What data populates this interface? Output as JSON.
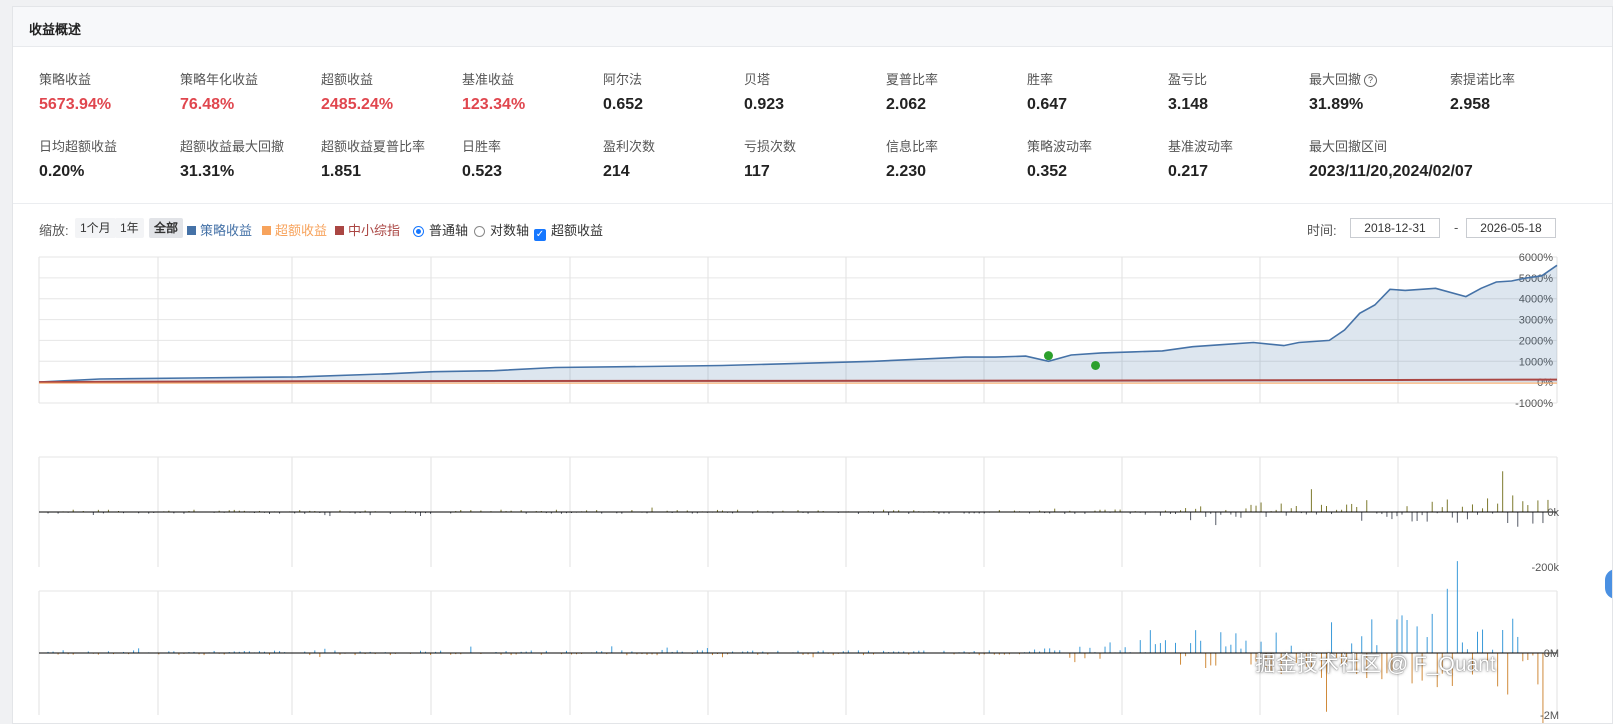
{
  "panel": {
    "title": "收益概述"
  },
  "metrics_row1": [
    {
      "label": "策略收益",
      "value": "5673.94%",
      "red": true
    },
    {
      "label": "策略年化收益",
      "value": "76.48%",
      "red": true
    },
    {
      "label": "超额收益",
      "value": "2485.24%",
      "red": true
    },
    {
      "label": "基准收益",
      "value": "123.34%",
      "red": true
    },
    {
      "label": "阿尔法",
      "value": "0.652",
      "red": false
    },
    {
      "label": "贝塔",
      "value": "0.923",
      "red": false
    },
    {
      "label": "夏普比率",
      "value": "2.062",
      "red": false
    },
    {
      "label": "胜率",
      "value": "0.647",
      "red": false
    },
    {
      "label": "盈亏比",
      "value": "3.148",
      "red": false
    },
    {
      "label": "最大回撤",
      "value": "31.89%",
      "red": false,
      "help": "?"
    },
    {
      "label": "索提诺比率",
      "value": "2.958",
      "red": false
    }
  ],
  "metrics_row2": [
    {
      "label": "日均超额收益",
      "value": "0.20%"
    },
    {
      "label": "超额收益最大回撤",
      "value": "31.31%"
    },
    {
      "label": "超额收益夏普比率",
      "value": "1.851"
    },
    {
      "label": "日胜率",
      "value": "0.523"
    },
    {
      "label": "盈利次数",
      "value": "214"
    },
    {
      "label": "亏损次数",
      "value": "117"
    },
    {
      "label": "信息比率",
      "value": "2.230"
    },
    {
      "label": "策略波动率",
      "value": "0.352"
    },
    {
      "label": "基准波动率",
      "value": "0.217"
    },
    {
      "label": "最大回撤区间",
      "value": "2023/11/20,2024/02/07"
    }
  ],
  "toolbar": {
    "zoom_label": "缩放:",
    "zoom_options": [
      "1个月",
      "1年",
      "全部"
    ],
    "legend": [
      {
        "name": "策略收益",
        "color": "#4572a7"
      },
      {
        "name": "超额收益",
        "color": "#f7a35c"
      },
      {
        "name": "中小综指",
        "color": "#aa4643"
      }
    ],
    "axis_options": [
      "普通轴",
      "对数轴"
    ],
    "excess_toggle": "超额收益",
    "time_label": "时间:",
    "date_from": "2018-12-31",
    "date_sep": "-",
    "date_to": "2026-05-18",
    "check_mark": "✓"
  },
  "chart_data": [
    {
      "type": "area",
      "ylim": [
        -1000,
        6000
      ],
      "ytick_labels": [
        "6000%",
        "5000%",
        "4000%",
        "3000%",
        "2000%",
        "1000%",
        "0%",
        "-1000%"
      ],
      "yticks": [
        6000,
        5000,
        4000,
        3000,
        2000,
        1000,
        0,
        -1000
      ],
      "x_range": [
        0,
        100
      ],
      "series": [
        {
          "name": "策略收益",
          "color": "#4572a7",
          "x": [
            0,
            4,
            10,
            17,
            23,
            26,
            30,
            34,
            40,
            45,
            50,
            55,
            58,
            61,
            63,
            65,
            66.5,
            68,
            70,
            72,
            74,
            76,
            78,
            80,
            82,
            83,
            85,
            86,
            87,
            88,
            89,
            90,
            92,
            94,
            95,
            96,
            97,
            98,
            99,
            100
          ],
          "y": [
            0,
            150,
            200,
            250,
            400,
            500,
            550,
            700,
            750,
            800,
            900,
            1000,
            1100,
            1200,
            1200,
            1250,
            1000,
            1300,
            1400,
            1450,
            1500,
            1700,
            1800,
            1900,
            1750,
            1900,
            2000,
            2500,
            3300,
            3700,
            4450,
            4400,
            4500,
            4100,
            4500,
            4800,
            4850,
            5000,
            5100,
            5600
          ]
        },
        {
          "name": "超额收益",
          "color": "#f7a35c",
          "x": [
            0,
            100
          ],
          "y": [
            0,
            0
          ]
        },
        {
          "name": "中小综指",
          "color": "#aa4643",
          "x": [
            0,
            20,
            40,
            60,
            80,
            100
          ],
          "y": [
            0,
            50,
            60,
            70,
            90,
            120
          ]
        }
      ],
      "markers": [
        {
          "x": 66.5,
          "y": 1270,
          "color": "#2ca02c"
        },
        {
          "x": 69.6,
          "y": 800,
          "color": "#2ca02c"
        }
      ]
    },
    {
      "type": "bar",
      "ylim": [
        -200,
        200
      ],
      "ytick_labels": [
        "0k",
        "-200k"
      ],
      "yticks": [
        0,
        -200
      ]
    },
    {
      "type": "bar",
      "ylim": [
        -2,
        2
      ],
      "ytick_labels": [
        "0M",
        "-2M"
      ],
      "yticks": [
        0,
        -2
      ]
    }
  ],
  "watermark": "掘金技术社区 @ F_Quant"
}
